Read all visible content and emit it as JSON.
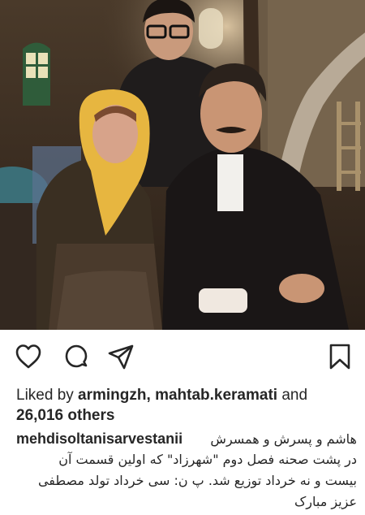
{
  "post": {
    "image_description_icon": "photo"
  },
  "actions": {
    "like_icon": "heart-outline-icon",
    "comment_icon": "comment-bubble-icon",
    "share_icon": "paper-plane-icon",
    "save_icon": "bookmark-icon"
  },
  "likes": {
    "prefix": "Liked by ",
    "user1": "armingzh",
    "separator": ", ",
    "user2": "mahtab.keramati",
    "and": " and",
    "count": "26,016 others"
  },
  "caption": {
    "username": "mehdisoltanisarvestanii",
    "line1": "هاشم و پسرش و همسرش",
    "line2": "در پشت صحنه فصل دوم \"شهرزاد\" که اولین قسمت آن",
    "line3": "بیست و نه خرداد توزیع شد. پ ن: سی خرداد تولد مصطفی",
    "line4": "عزیز مبارک"
  },
  "colors": {
    "text": "#262626",
    "background": "#ffffff"
  }
}
